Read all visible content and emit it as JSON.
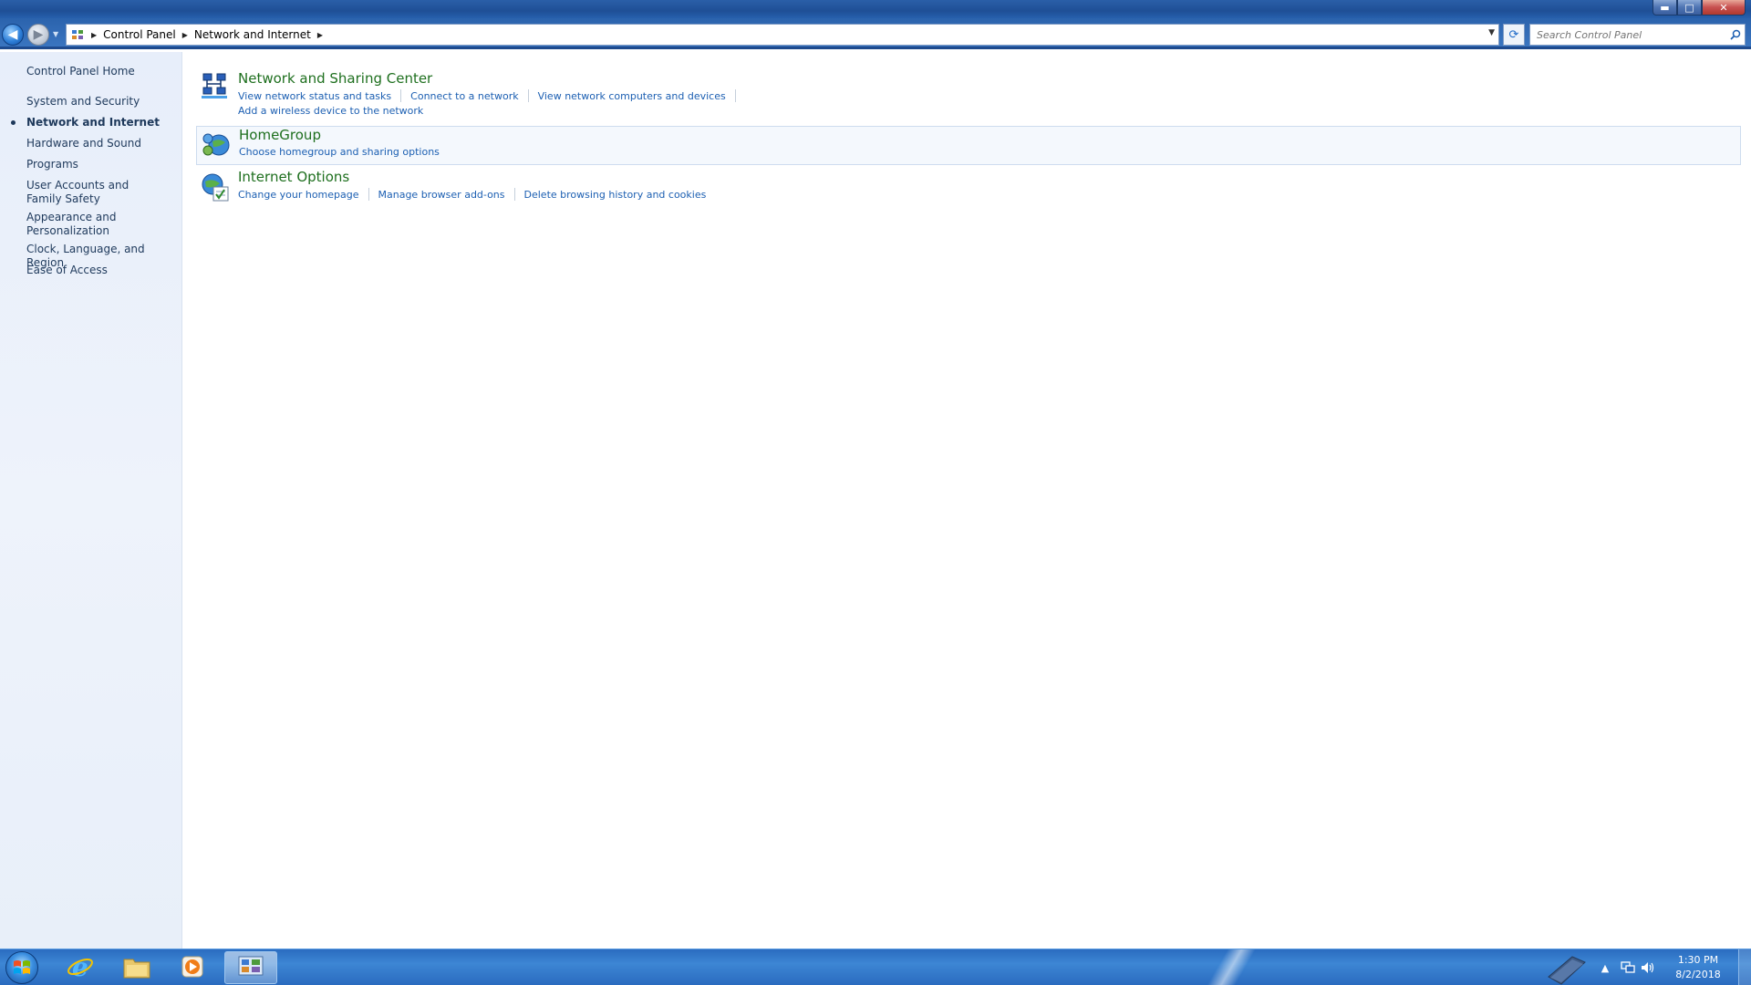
{
  "window": {
    "controls": {
      "minimize": "▬",
      "maximize": "□",
      "close": "✕"
    }
  },
  "address_bar": {
    "back_glyph": "◀",
    "forward_glyph": "▶",
    "crumbs": [
      "Control Panel",
      "Network and Internet"
    ],
    "search_placeholder": "Search Control Panel",
    "refresh_glyph": "⟳"
  },
  "left_nav": {
    "home": "Control Panel Home",
    "items": [
      {
        "label": "System and Security",
        "active": false
      },
      {
        "label": "Network and Internet",
        "active": true
      },
      {
        "label": "Hardware and Sound",
        "active": false
      },
      {
        "label": "Programs",
        "active": false
      },
      {
        "label": "User Accounts and Family Safety",
        "active": false
      },
      {
        "label": "Appearance and Personalization",
        "active": false
      },
      {
        "label": "Clock, Language, and Region",
        "active": false
      },
      {
        "label": "Ease of Access",
        "active": false
      }
    ]
  },
  "categories": [
    {
      "title": "Network and Sharing Center",
      "icon": "network-sharing-icon",
      "links": [
        "View network status and tasks",
        "Connect to a network",
        "View network computers and devices",
        "Add a wireless device to the network"
      ]
    },
    {
      "title": "HomeGroup",
      "icon": "homegroup-icon",
      "links": [
        "Choose homegroup and sharing options"
      ]
    },
    {
      "title": "Internet Options",
      "icon": "internet-options-icon",
      "links": [
        "Change your homepage",
        "Manage browser add-ons",
        "Delete browsing history and cookies"
      ]
    }
  ],
  "taskbar": {
    "apps": [
      {
        "name": "internet-explorer",
        "active": false
      },
      {
        "name": "file-explorer",
        "active": false
      },
      {
        "name": "media-player",
        "active": false
      },
      {
        "name": "control-panel",
        "active": true
      }
    ],
    "tray_expand": "▲",
    "clock_time": "1:30 PM",
    "clock_date": "8/2/2018"
  },
  "colors": {
    "link": "#1c5fb2",
    "category_title": "#1e6f1e",
    "nav_text": "#1e395b",
    "taskbar": "#2a6cc0"
  }
}
